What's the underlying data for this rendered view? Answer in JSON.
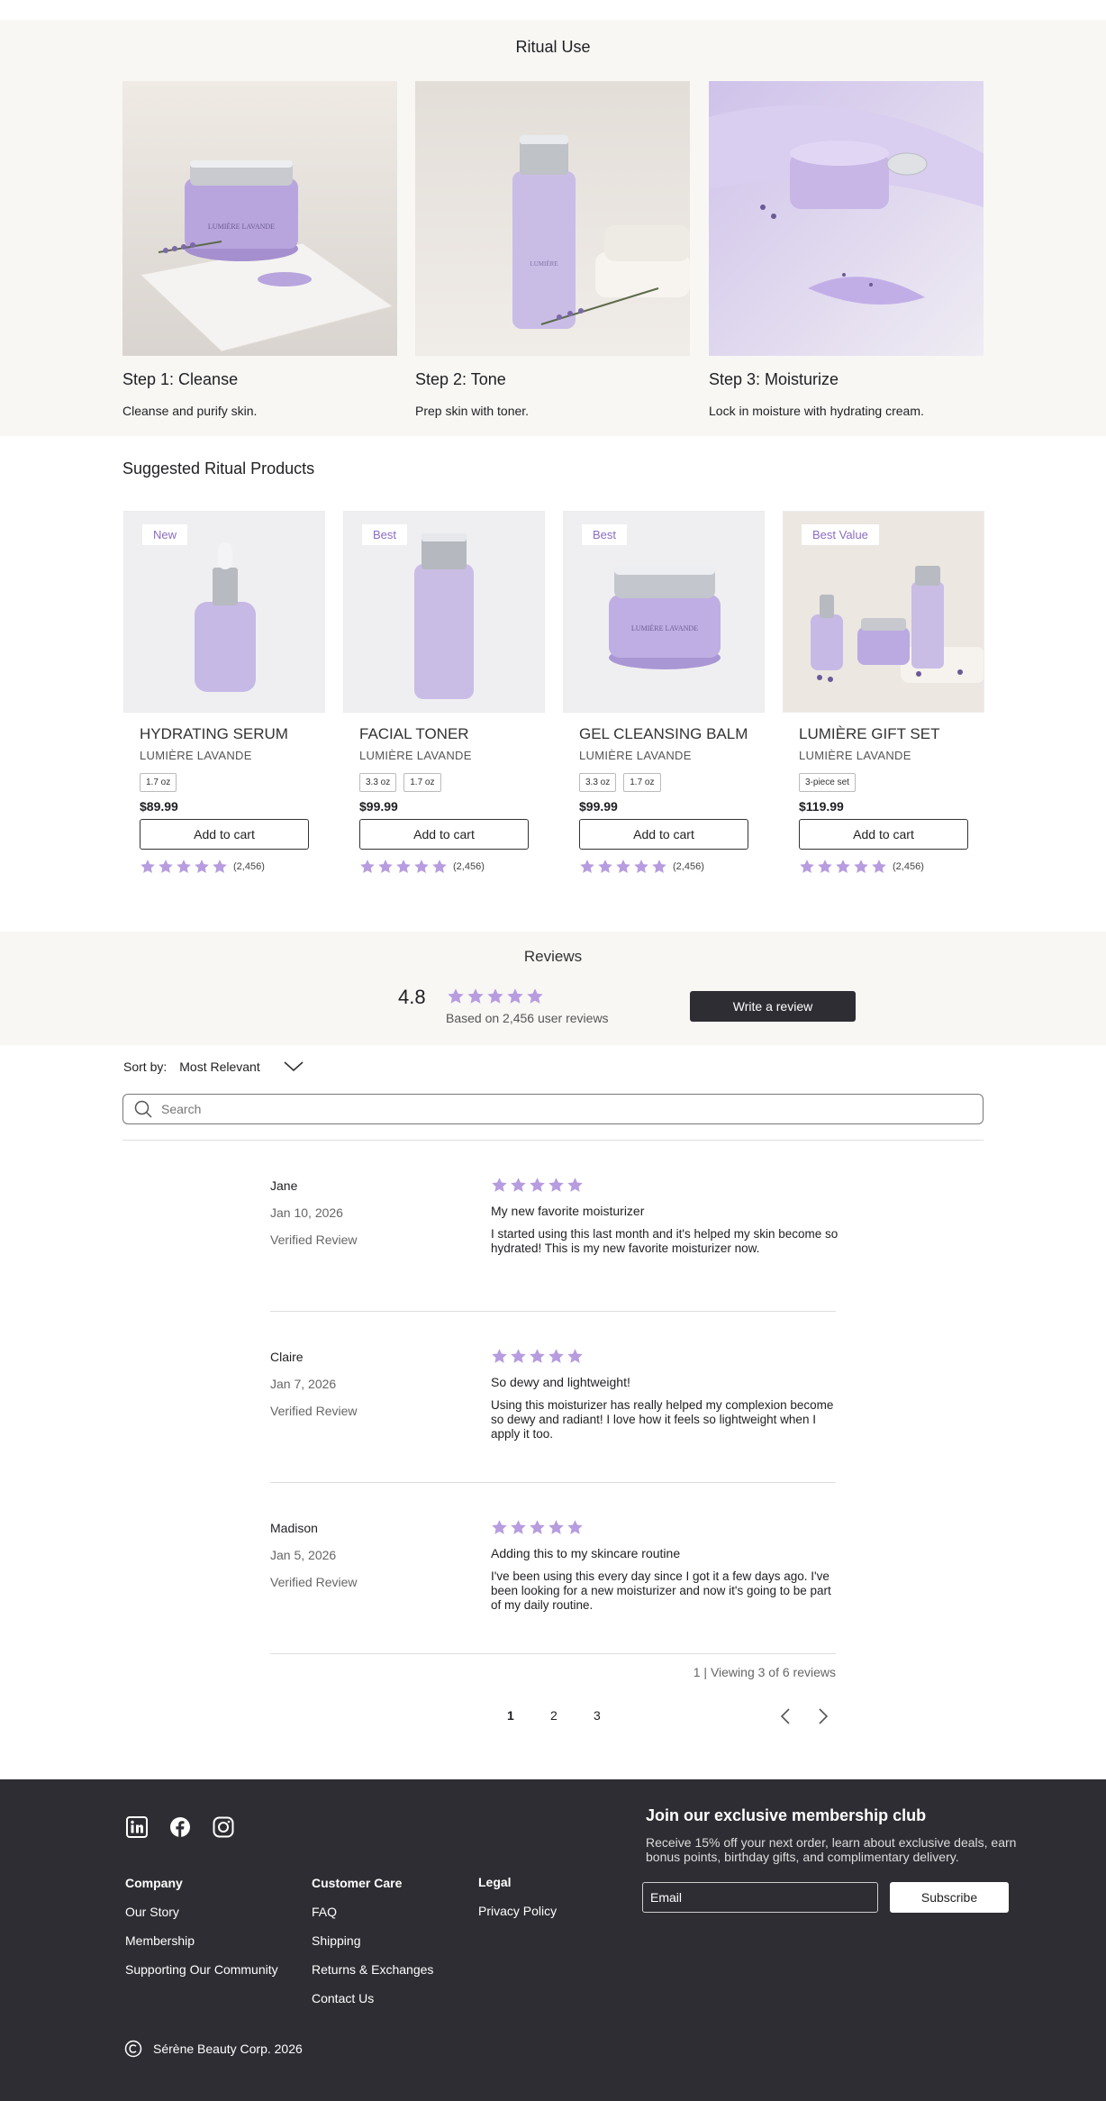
{
  "colors": {
    "accent": "#b79ce0",
    "badge_text": "#8b6cc2",
    "band_bg": "#f8f7f4",
    "dark": "#2e2d33"
  },
  "ritual": {
    "title": "Ritual Use",
    "steps": [
      {
        "heading": "Step 1: Cleanse",
        "desc": "Cleanse and purify skin."
      },
      {
        "heading": "Step 2: Tone",
        "desc": "Prep skin with toner."
      },
      {
        "heading": "Step 3: Moisturize",
        "desc": "Lock in moisture with hydrating cream."
      }
    ]
  },
  "suggested": {
    "title": "Suggested Ritual Products",
    "products": [
      {
        "badge": "New",
        "name": "HYDRATING SERUM",
        "brand": "LUMIÈRE LAVANDE",
        "sizes": [
          "1.7 oz"
        ],
        "price": "$89.99",
        "cart": "Add to cart",
        "rating": 5,
        "count": "(2,456)"
      },
      {
        "badge": "Best",
        "name": "FACIAL TONER",
        "brand": "LUMIÈRE LAVANDE",
        "sizes": [
          "3.3 oz",
          "1.7 oz"
        ],
        "price": "$99.99",
        "cart": "Add to cart",
        "rating": 5,
        "count": "(2,456)"
      },
      {
        "badge": "Best",
        "name": "GEL CLEANSING BALM",
        "brand": "LUMIÈRE LAVANDE",
        "sizes": [
          "3.3 oz",
          "1.7 oz"
        ],
        "price": "$99.99",
        "cart": "Add to cart",
        "rating": 5,
        "count": "(2,456)"
      },
      {
        "badge": "Best Value",
        "name": "LUMIÈRE GIFT SET",
        "brand": "LUMIÈRE LAVANDE",
        "sizes": [
          "3-piece set"
        ],
        "price": "$119.99",
        "cart": "Add to cart",
        "rating": 5,
        "count": "(2,456)"
      }
    ]
  },
  "reviews": {
    "title": "Reviews",
    "average": "4.8",
    "based_on": "Based on 2,456 user reviews",
    "write_label": "Write a review",
    "sort_label": "Sort by:",
    "sort_value": "Most Relevant",
    "search_placeholder": "Search",
    "items": [
      {
        "author": "Jane",
        "date": "Jan 10, 2026",
        "verified": "Verified Review",
        "rating": 5,
        "title": "My new favorite moisturizer",
        "body": "I started using this last month and it's helped my skin become so hydrated! This is my new favorite moisturizer now."
      },
      {
        "author": "Claire",
        "date": "Jan 7, 2026",
        "verified": "Verified Review",
        "rating": 5,
        "title": "So dewy and lightweight!",
        "body": "Using this moisturizer has really helped my complexion become so dewy and radiant! I love how it feels so lightweight when I apply it too."
      },
      {
        "author": "Madison",
        "date": "Jan 5, 2026",
        "verified": "Verified Review",
        "rating": 5,
        "title": "Adding this to my skincare routine",
        "body": "I've been using this every day since I got it a few days ago. I've been looking for a new moisturizer and now it's going to be part of my daily routine."
      }
    ],
    "viewing": "1 | Viewing 3 of 6 reviews",
    "pages": [
      "1",
      "2",
      "3"
    ],
    "current_page": "1"
  },
  "footer": {
    "social": [
      "linkedin-icon",
      "facebook-icon",
      "instagram-icon"
    ],
    "company": {
      "heading": "Company",
      "links": [
        "Our Story",
        "Membership",
        "Supporting Our Community"
      ]
    },
    "care": {
      "heading": "Customer Care",
      "links": [
        "FAQ",
        "Shipping",
        "Returns & Exchanges",
        "Contact Us"
      ]
    },
    "legal": {
      "heading": "Legal",
      "links": [
        "Privacy Policy"
      ]
    },
    "join_title": "Join our exclusive membership club",
    "join_text": "Receive 15% off your next order, learn about exclusive deals, earn bonus points, birthday gifts, and complimentary delivery.",
    "email_placeholder": "Email",
    "subscribe_label": "Subscribe",
    "copyright": "Sérène Beauty Corp. 2026"
  }
}
